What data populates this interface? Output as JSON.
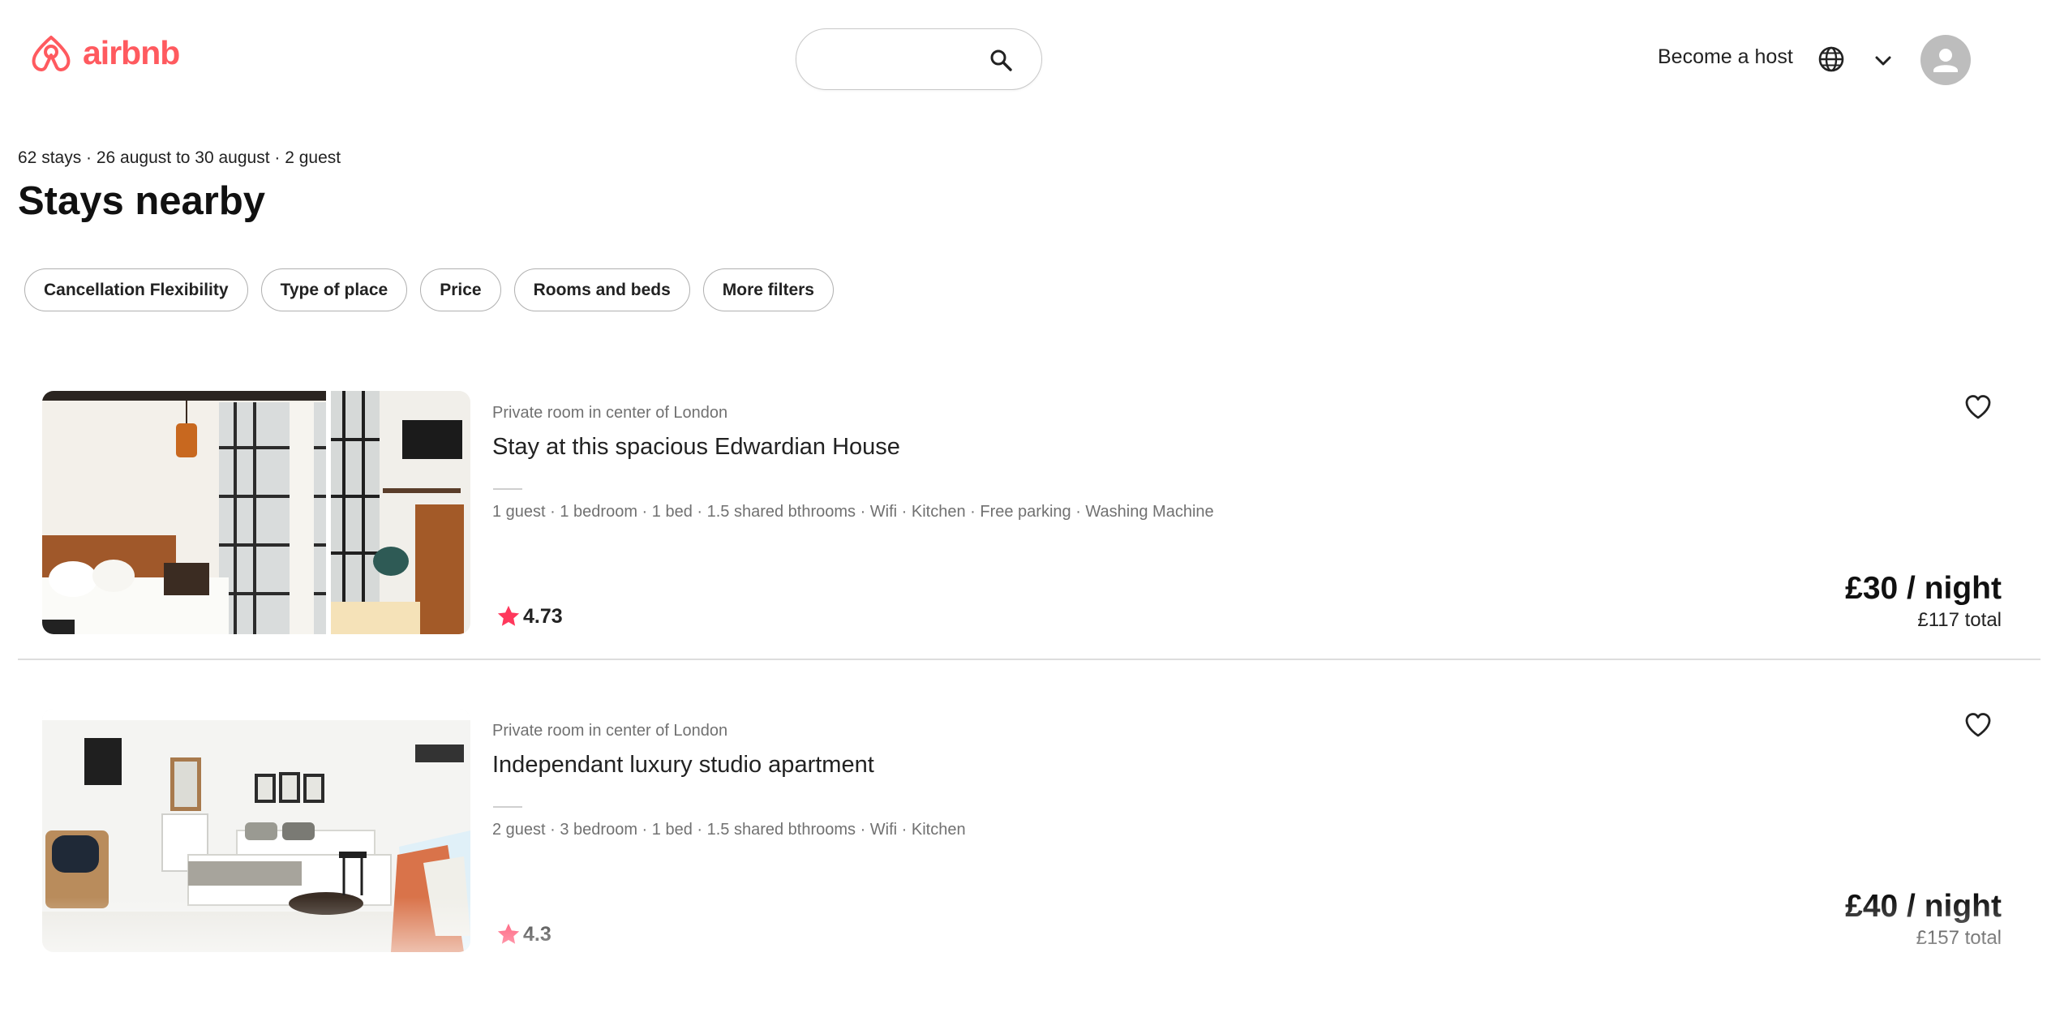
{
  "brand": {
    "name": "airbnb",
    "color": "#ff5a5f"
  },
  "search": {
    "value": "",
    "placeholder": "",
    "icon": "search-icon"
  },
  "nav": {
    "become_host": "Become a host",
    "language_icon": "globe-icon",
    "menu_icon": "chevron-down-icon",
    "avatar_icon": "user-icon"
  },
  "results": {
    "summary": "62 stays · 26 august to 30 august · 2 guest",
    "title": "Stays nearby"
  },
  "filters": [
    "Cancellation Flexibility",
    "Type of place",
    "Price",
    "Rooms and beds",
    "More filters"
  ],
  "listings": [
    {
      "type": "Private room in center of London",
      "title": "Stay at this spacious Edwardian House",
      "amenities": "1 guest · 1 bedroom · 1 bed · 1.5 shared bthrooms · Wifi · Kitchen · Free parking · Washing Machine",
      "rating": "4.73",
      "price_night": "£30 / night",
      "price_total": "£117 total",
      "saved": false
    },
    {
      "type": "Private room in center of London",
      "title": "Independant luxury studio apartment",
      "amenities": "2 guest · 3 bedroom · 1 bed · 1.5 shared bthrooms · Wifi · Kitchen",
      "rating": "4.3",
      "price_night": "£40 / night",
      "price_total": "£157 total",
      "saved": false
    }
  ],
  "colors": {
    "star": "#ff385c",
    "text": "#222222",
    "muted": "#717171",
    "border": "#b0b0b0",
    "divider": "#dddddd"
  }
}
